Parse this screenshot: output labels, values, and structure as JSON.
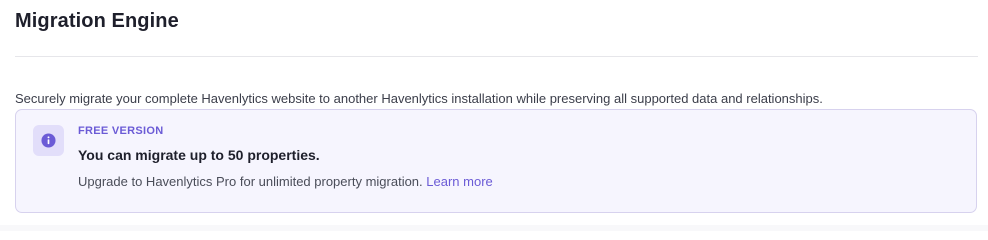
{
  "header": {
    "title": "Migration Engine"
  },
  "description": "Securely migrate your complete Havenlytics website to another Havenlytics installation while preserving all supported data and relationships.",
  "notice": {
    "icon": "info-icon",
    "label": "FREE VERSION",
    "heading": "You can migrate up to 50 properties.",
    "body": "Upgrade to Havenlytics Pro for unlimited property migration.",
    "link_label": "Learn more",
    "accent_color": "#6b5bd6"
  }
}
